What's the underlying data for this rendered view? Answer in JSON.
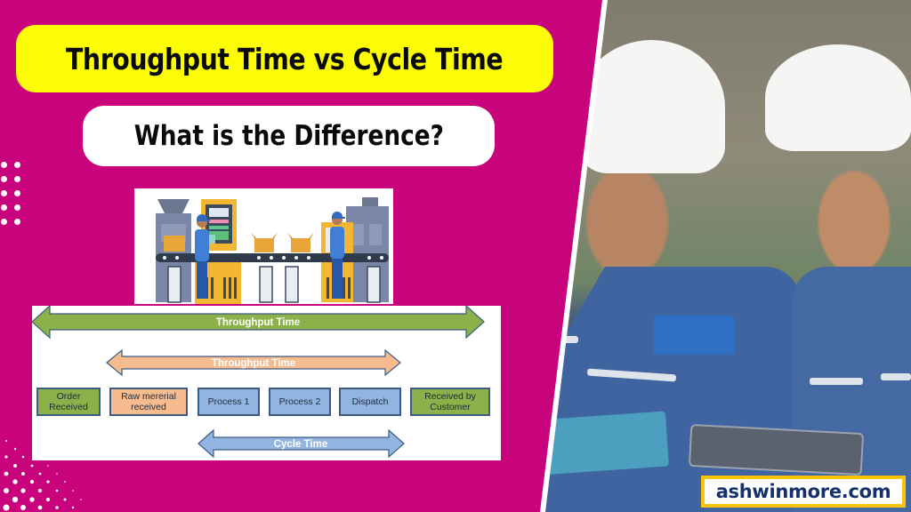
{
  "header": {
    "title": "Throughput Time vs Cycle Time",
    "subtitle": "What is the Difference?"
  },
  "diagram": {
    "arrows": [
      {
        "label": "Throughput Time",
        "color": "#8bb24a",
        "span": "Order Received to Received by Customer"
      },
      {
        "label": "Throughput Time",
        "color": "#f7bb90",
        "span": "Raw mererial received to Dispatch"
      },
      {
        "label": "Cycle Time",
        "color": "#92b4e0",
        "span": "Process 1 to Dispatch"
      }
    ],
    "steps": [
      {
        "label": "Order Received",
        "color": "#8bb24a"
      },
      {
        "label": "Raw mererial received",
        "color": "#f7bb90"
      },
      {
        "label": "Process 1",
        "color": "#92b4e0"
      },
      {
        "label": "Process 2",
        "color": "#92b4e0"
      },
      {
        "label": "Dispatch",
        "color": "#92b4e0"
      },
      {
        "label": "Received by Customer",
        "color": "#8bb24a"
      }
    ]
  },
  "brand": {
    "site": "ashwinmore.com"
  },
  "colors": {
    "background": "#c8037b",
    "title_pill": "#fcfc06",
    "brand_border": "#fbc40b",
    "brand_text": "#16306b"
  },
  "images": {
    "factory": "factory-assembly-line-illustration",
    "photo": "two-engineers-hard-hats-with-tablet-and-clipboard"
  }
}
